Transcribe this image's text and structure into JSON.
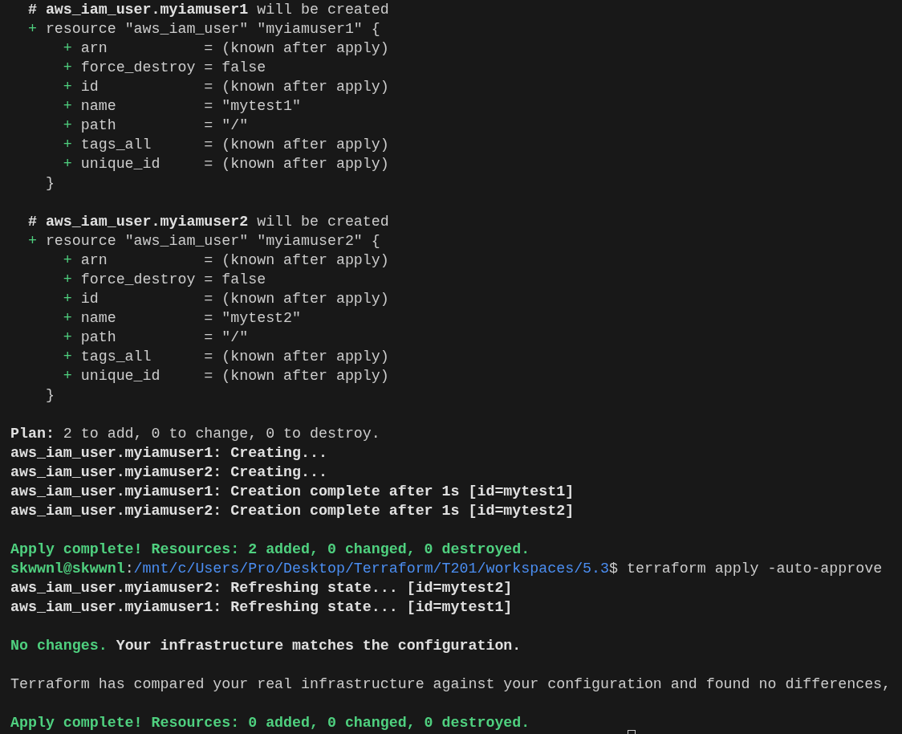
{
  "terminal": {
    "lines": [
      {
        "kind": "comment",
        "address": "# aws_iam_user.myiamuser1",
        "note": "will be created"
      },
      {
        "kind": "resource",
        "marker": "+",
        "text": "resource \"aws_iam_user\" \"myiamuser1\" {"
      },
      {
        "kind": "attribute",
        "marker": "+",
        "text": "arn           = (known after apply)"
      },
      {
        "kind": "attribute",
        "marker": "+",
        "text": "force_destroy = false"
      },
      {
        "kind": "attribute",
        "marker": "+",
        "text": "id            = (known after apply)"
      },
      {
        "kind": "attribute",
        "marker": "+",
        "text": "name          = \"mytest1\""
      },
      {
        "kind": "attribute",
        "marker": "+",
        "text": "path          = \"/\""
      },
      {
        "kind": "attribute",
        "marker": "+",
        "text": "tags_all      = (known after apply)"
      },
      {
        "kind": "attribute",
        "marker": "+",
        "text": "unique_id     = (known after apply)"
      },
      {
        "kind": "close",
        "text": "}"
      },
      {
        "kind": "blank"
      },
      {
        "kind": "comment",
        "address": "# aws_iam_user.myiamuser2",
        "note": "will be created"
      },
      {
        "kind": "resource",
        "marker": "+",
        "text": "resource \"aws_iam_user\" \"myiamuser2\" {"
      },
      {
        "kind": "attribute",
        "marker": "+",
        "text": "arn           = (known after apply)"
      },
      {
        "kind": "attribute",
        "marker": "+",
        "text": "force_destroy = false"
      },
      {
        "kind": "attribute",
        "marker": "+",
        "text": "id            = (known after apply)"
      },
      {
        "kind": "attribute",
        "marker": "+",
        "text": "name          = \"mytest2\""
      },
      {
        "kind": "attribute",
        "marker": "+",
        "text": "path          = \"/\""
      },
      {
        "kind": "attribute",
        "marker": "+",
        "text": "tags_all      = (known after apply)"
      },
      {
        "kind": "attribute",
        "marker": "+",
        "text": "unique_id     = (known after apply)"
      },
      {
        "kind": "close",
        "text": "}"
      },
      {
        "kind": "blank"
      },
      {
        "kind": "plan",
        "label": "Plan:",
        "text": "2 to add, 0 to change, 0 to destroy."
      },
      {
        "kind": "log",
        "text": "aws_iam_user.myiamuser1: Creating..."
      },
      {
        "kind": "log",
        "text": "aws_iam_user.myiamuser2: Creating..."
      },
      {
        "kind": "log",
        "text": "aws_iam_user.myiamuser1: Creation complete after 1s [id=mytest1]"
      },
      {
        "kind": "log",
        "text": "aws_iam_user.myiamuser2: Creation complete after 1s [id=mytest2]"
      },
      {
        "kind": "blank"
      },
      {
        "kind": "success",
        "text": "Apply complete! Resources: 2 added, 0 changed, 0 destroyed."
      },
      {
        "kind": "prompt",
        "user": "skwwnl@skwwnl",
        "separator": ":",
        "path": "/mnt/c/Users/Pro/Desktop/Terraform/T201/workspaces/5.3",
        "symbol": "$",
        "command": "terraform apply -auto-approve"
      },
      {
        "kind": "log",
        "text": "aws_iam_user.myiamuser2: Refreshing state... [id=mytest2]"
      },
      {
        "kind": "log",
        "text": "aws_iam_user.myiamuser1: Refreshing state... [id=mytest1]"
      },
      {
        "kind": "blank"
      },
      {
        "kind": "summary",
        "status": "No changes.",
        "text": "Your infrastructure matches the configuration."
      },
      {
        "kind": "blank"
      },
      {
        "kind": "info",
        "text": "Terraform has compared your real infrastructure against your configuration and found no differences,"
      },
      {
        "kind": "blank"
      },
      {
        "kind": "success",
        "text": "Apply complete! Resources: 0 added, 0 changed, 0 destroyed."
      }
    ]
  }
}
